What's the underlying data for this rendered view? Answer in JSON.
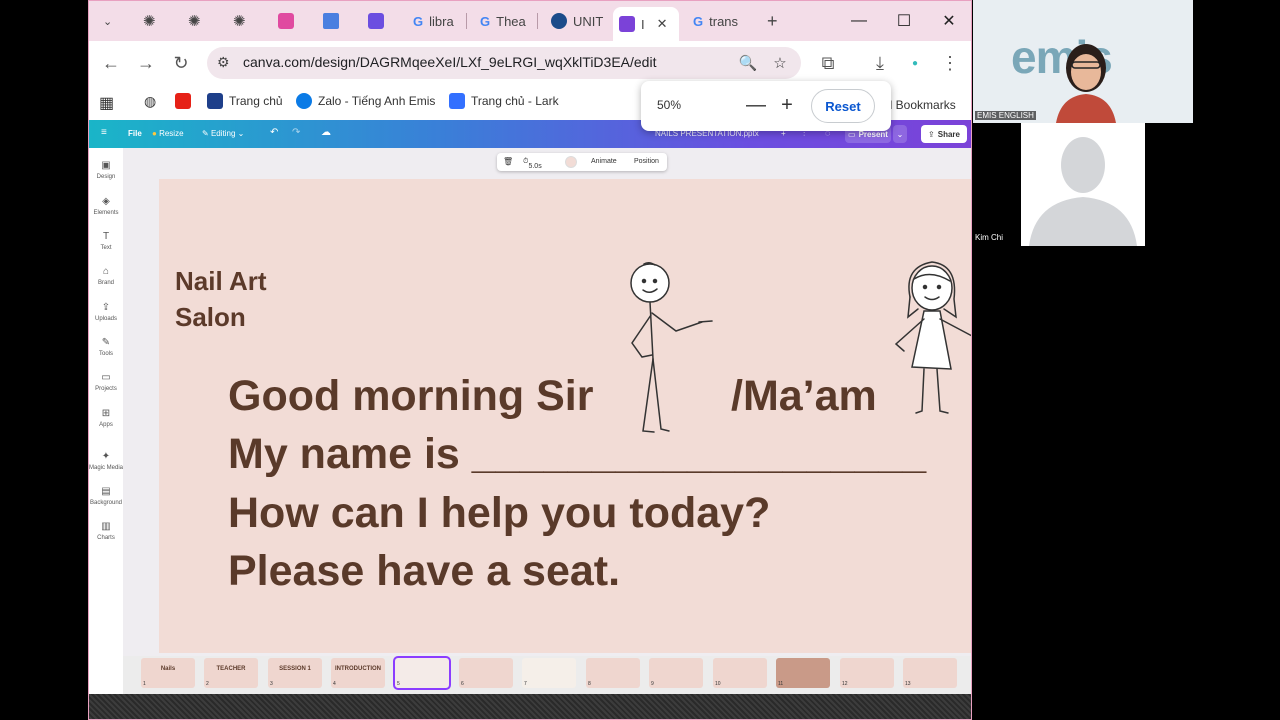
{
  "browser": {
    "tabs": [
      {
        "label": "",
        "icon": "chatgpt-icon"
      },
      {
        "label": "",
        "icon": "chatgpt-icon"
      },
      {
        "label": "",
        "icon": "chatgpt-icon"
      },
      {
        "label": "",
        "icon": "figma-icon"
      },
      {
        "label": "",
        "icon": "docs-icon"
      },
      {
        "label": "",
        "icon": "canva-icon"
      },
      {
        "label": "libra",
        "icon": "google-icon"
      },
      {
        "label": "Thea",
        "icon": "google-icon"
      },
      {
        "label": "UNIT",
        "icon": "grammarly-icon"
      },
      {
        "label": "I",
        "icon": "canva-icon"
      },
      {
        "label": "trans",
        "icon": "google-icon"
      }
    ],
    "url": "canva.com/design/DAGRMqeeXeI/LXf_9eLRGI_wqXklTiD3EA/edit",
    "bookmarks": [
      {
        "label": "Trang chủ",
        "icon": "center-icon"
      },
      {
        "label": "Zalo - Tiếng Anh Emis",
        "icon": "zalo-icon"
      },
      {
        "label": "Trang chủ - Lark",
        "icon": "lark-icon"
      }
    ],
    "all_bookmarks": "All Bookmarks",
    "more": "»",
    "zoom": {
      "value": "50%",
      "minus": "—",
      "plus": "+",
      "reset": "Reset"
    }
  },
  "canva": {
    "menu": "File",
    "resize": "Resize",
    "editing": "Editing",
    "filename": "NAILS PRESENTATION.pptx",
    "present": "Present",
    "share": "Share",
    "rail": [
      "Design",
      "Elements",
      "Text",
      "Brand",
      "Uploads",
      "Tools",
      "Projects",
      "Apps",
      "Magic Media",
      "Background",
      "Charts"
    ],
    "element_toolbar": {
      "duration": "5.0s",
      "animate": "Animate",
      "position": "Position"
    }
  },
  "slide": {
    "title_line1": "Nail Art",
    "title_line2": "Salon",
    "line1a": "Good morning Sir",
    "line1b": "/Ma’am",
    "line1c": "!",
    "line2": "My name is ___________________",
    "line3": "How can I help you today?",
    "line4": "Please have a seat."
  },
  "filmstrip": [
    {
      "num": "1",
      "label": "Nails"
    },
    {
      "num": "2",
      "label": "TEACHER"
    },
    {
      "num": "3",
      "label": "SESSION 1"
    },
    {
      "num": "4",
      "label": "INTRODUCTION"
    },
    {
      "num": "5",
      "label": ""
    },
    {
      "num": "6",
      "label": ""
    },
    {
      "num": "7",
      "label": ""
    },
    {
      "num": "8",
      "label": ""
    },
    {
      "num": "9",
      "label": ""
    },
    {
      "num": "10",
      "label": ""
    },
    {
      "num": "11",
      "label": ""
    },
    {
      "num": "12",
      "label": ""
    },
    {
      "num": "13",
      "label": ""
    }
  ],
  "video": {
    "panel1_logo": "emis",
    "panel1_label": "EMIS ENGLISH",
    "panel2_label": "Kim Chi"
  },
  "colors": {
    "slide_bg": "#f2dcd6",
    "slide_text": "#5a3a2a",
    "accent": "#8b3dff"
  }
}
